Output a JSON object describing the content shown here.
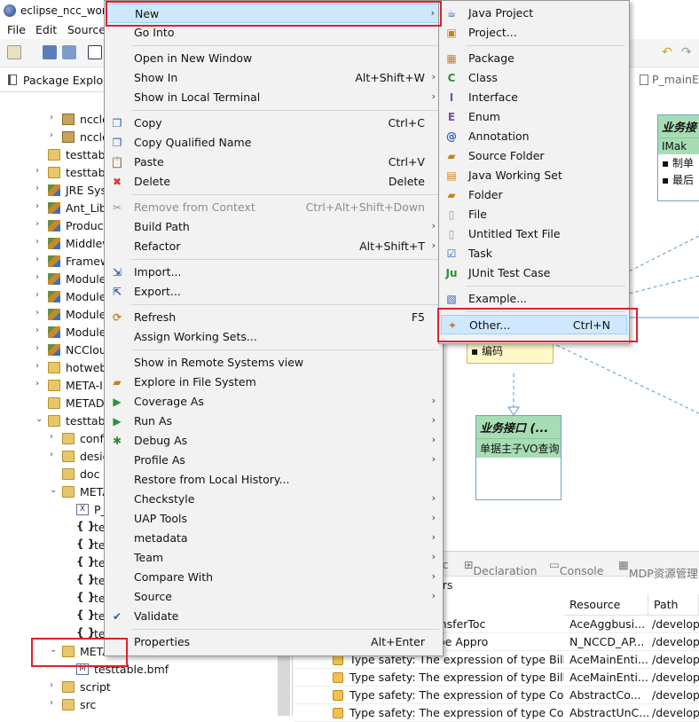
{
  "window": {
    "title": "eclipse_ncc_worl"
  },
  "menubar": {
    "items": [
      "File",
      "Edit",
      "Source"
    ]
  },
  "explorer": {
    "tab_label": "Package Explor",
    "items": [
      {
        "label": "nccloud",
        "indent": 2,
        "arrow": "›",
        "icon": "proj"
      },
      {
        "label": "nccloud",
        "indent": 2,
        "arrow": "›",
        "icon": "proj"
      },
      {
        "label": "testtable/",
        "indent": 1,
        "arrow": "",
        "icon": "folder"
      },
      {
        "label": "testtable/",
        "indent": 1,
        "arrow": "›",
        "icon": "folder"
      },
      {
        "label": "JRE System",
        "indent": 1,
        "arrow": "›",
        "icon": "lib"
      },
      {
        "label": "Ant_Librar",
        "indent": 1,
        "arrow": "›",
        "icon": "lib"
      },
      {
        "label": "Product_C",
        "indent": 1,
        "arrow": "›",
        "icon": "lib"
      },
      {
        "label": "Middlewa",
        "indent": 1,
        "arrow": "›",
        "icon": "lib"
      },
      {
        "label": "Framewor",
        "indent": 1,
        "arrow": "›",
        "icon": "lib"
      },
      {
        "label": "Module_P",
        "indent": 1,
        "arrow": "›",
        "icon": "lib"
      },
      {
        "label": "Module_C",
        "indent": 1,
        "arrow": "›",
        "icon": "lib"
      },
      {
        "label": "Module_P",
        "indent": 1,
        "arrow": "›",
        "icon": "lib"
      },
      {
        "label": "Module_L",
        "indent": 1,
        "arrow": "›",
        "icon": "lib"
      },
      {
        "label": "NCCloud_",
        "indent": 1,
        "arrow": "›",
        "icon": "lib"
      },
      {
        "label": "hotwebs",
        "indent": 1,
        "arrow": "›",
        "icon": "folder"
      },
      {
        "label": "META-INF",
        "indent": 1,
        "arrow": "›",
        "icon": "folder"
      },
      {
        "label": "METADAT",
        "indent": 1,
        "arrow": "",
        "icon": "folder"
      },
      {
        "label": "testtable",
        "indent": 1,
        "arrow": "⌄",
        "icon": "folder"
      },
      {
        "label": "config",
        "indent": 2,
        "arrow": "›",
        "icon": "folder"
      },
      {
        "label": "design",
        "indent": 2,
        "arrow": "›",
        "icon": "folder"
      },
      {
        "label": "doc",
        "indent": 2,
        "arrow": "",
        "icon": "folder"
      },
      {
        "label": "META-",
        "indent": 2,
        "arrow": "⌄",
        "icon": "folder"
      },
      {
        "label": "P_m",
        "indent": 3,
        "arrow": "",
        "icon": "xml"
      },
      {
        "label": "testt",
        "indent": 3,
        "arrow": "",
        "icon": "json"
      },
      {
        "label": "testt",
        "indent": 3,
        "arrow": "",
        "icon": "json"
      },
      {
        "label": "testt",
        "indent": 3,
        "arrow": "",
        "icon": "json"
      },
      {
        "label": "testt",
        "indent": 3,
        "arrow": "",
        "icon": "json"
      },
      {
        "label": "testt",
        "indent": 3,
        "arrow": "",
        "icon": "json"
      },
      {
        "label": "testt",
        "indent": 3,
        "arrow": "",
        "icon": "json"
      },
      {
        "label": "testt",
        "indent": 3,
        "arrow": "",
        "icon": "json"
      },
      {
        "label": "METADATA",
        "indent": 2,
        "arrow": "⌄",
        "icon": "folder"
      },
      {
        "label": "testtable.bmf",
        "indent": 3,
        "arrow": "",
        "icon": "bmf"
      },
      {
        "label": "script",
        "indent": 2,
        "arrow": "›",
        "icon": "folder"
      },
      {
        "label": "src",
        "indent": 2,
        "arrow": "›",
        "icon": "folder"
      }
    ]
  },
  "editor": {
    "tab_label": "P_mainEn",
    "uml_right": {
      "title": "业务接",
      "subtitle": "IMak",
      "items": [
        "制单",
        "最后"
      ]
    },
    "uml_mid_items": [
      "编码"
    ],
    "uml_bottom": {
      "title": "业务接口 (...",
      "subtitle": "单据主子VO查询"
    }
  },
  "bottom": {
    "tabs": [
      "oc",
      "Declaration",
      "Console",
      "MDP资源管理"
    ],
    "subtitle": "ers",
    "columns": [
      "Resource",
      "Path"
    ],
    "rows": [
      {
        "desc": "ocal variable transferToc",
        "resource": "AceAggbusi...",
        "path": "/develop"
      },
      {
        "desc": "expression of type Appro",
        "resource": "N_NCCD_AP...",
        "path": "/develop"
      },
      {
        "desc": "Type safety: The expression of type BillCo",
        "resource": "AceMainEnti...",
        "path": "/develop"
      },
      {
        "desc": "Type safety: The expression of type BillCo",
        "resource": "AceMainEnti...",
        "path": "/develop"
      },
      {
        "desc": "Type safety: The expression of type Collec",
        "resource": "AbstractCo...",
        "path": "/develop"
      },
      {
        "desc": "Type safety: The expression of type Collec",
        "resource": "AbstractUnC...",
        "path": "/develop"
      }
    ]
  },
  "context_menu": {
    "items": [
      {
        "label": "New",
        "shortcut": "",
        "submenu": true,
        "icon": "",
        "disabled": false,
        "highlighted": true
      },
      {
        "label": "Go Into",
        "shortcut": "",
        "submenu": false,
        "icon": "",
        "disabled": false
      },
      {
        "sep": true
      },
      {
        "label": "Open in New Window",
        "shortcut": "",
        "submenu": false,
        "icon": "",
        "disabled": false
      },
      {
        "label": "Show In",
        "shortcut": "Alt+Shift+W",
        "submenu": true,
        "icon": "",
        "disabled": false
      },
      {
        "label": "Show in Local Terminal",
        "shortcut": "",
        "submenu": true,
        "icon": "",
        "disabled": false
      },
      {
        "sep": true
      },
      {
        "label": "Copy",
        "shortcut": "Ctrl+C",
        "submenu": false,
        "icon": "copy",
        "disabled": false
      },
      {
        "label": "Copy Qualified Name",
        "shortcut": "",
        "submenu": false,
        "icon": "copy",
        "disabled": false
      },
      {
        "label": "Paste",
        "shortcut": "Ctrl+V",
        "submenu": false,
        "icon": "paste",
        "disabled": false
      },
      {
        "label": "Delete",
        "shortcut": "Delete",
        "submenu": false,
        "icon": "delete",
        "disabled": false
      },
      {
        "sep": true
      },
      {
        "label": "Remove from Context",
        "shortcut": "Ctrl+Alt+Shift+Down",
        "submenu": false,
        "icon": "remove",
        "disabled": true
      },
      {
        "label": "Build Path",
        "shortcut": "",
        "submenu": true,
        "icon": "",
        "disabled": false
      },
      {
        "label": "Refactor",
        "shortcut": "Alt+Shift+T",
        "submenu": true,
        "icon": "",
        "disabled": false
      },
      {
        "sep": true
      },
      {
        "label": "Import...",
        "shortcut": "",
        "submenu": false,
        "icon": "import",
        "disabled": false
      },
      {
        "label": "Export...",
        "shortcut": "",
        "submenu": false,
        "icon": "export",
        "disabled": false
      },
      {
        "sep": true
      },
      {
        "label": "Refresh",
        "shortcut": "F5",
        "submenu": false,
        "icon": "refresh",
        "disabled": false
      },
      {
        "label": "Assign Working Sets...",
        "shortcut": "",
        "submenu": false,
        "icon": "",
        "disabled": false
      },
      {
        "sep": true
      },
      {
        "label": "Show in Remote Systems view",
        "shortcut": "",
        "submenu": false,
        "icon": "",
        "disabled": false
      },
      {
        "label": "Explore in File System",
        "shortcut": "",
        "submenu": false,
        "icon": "folder",
        "disabled": false
      },
      {
        "label": "Coverage As",
        "shortcut": "",
        "submenu": true,
        "icon": "coverage",
        "disabled": false
      },
      {
        "label": "Run As",
        "shortcut": "",
        "submenu": true,
        "icon": "run",
        "disabled": false
      },
      {
        "label": "Debug As",
        "shortcut": "",
        "submenu": true,
        "icon": "debug",
        "disabled": false
      },
      {
        "label": "Profile As",
        "shortcut": "",
        "submenu": true,
        "icon": "",
        "disabled": false
      },
      {
        "label": "Restore from Local History...",
        "shortcut": "",
        "submenu": false,
        "icon": "",
        "disabled": false
      },
      {
        "label": "Checkstyle",
        "shortcut": "",
        "submenu": true,
        "icon": "",
        "disabled": false
      },
      {
        "label": "UAP Tools",
        "shortcut": "",
        "submenu": true,
        "icon": "",
        "disabled": false
      },
      {
        "label": "metadata",
        "shortcut": "",
        "submenu": true,
        "icon": "",
        "disabled": false
      },
      {
        "label": "Team",
        "shortcut": "",
        "submenu": true,
        "icon": "",
        "disabled": false
      },
      {
        "label": "Compare With",
        "shortcut": "",
        "submenu": true,
        "icon": "",
        "disabled": false
      },
      {
        "label": "Source",
        "shortcut": "",
        "submenu": true,
        "icon": "",
        "disabled": false
      },
      {
        "label": "Validate",
        "shortcut": "",
        "submenu": false,
        "icon": "check",
        "disabled": false
      },
      {
        "sep": true
      },
      {
        "label": "Properties",
        "shortcut": "Alt+Enter",
        "submenu": false,
        "icon": "",
        "disabled": false
      }
    ]
  },
  "new_submenu": {
    "items": [
      {
        "label": "Java Project",
        "shortcut": "",
        "icon": "java-project"
      },
      {
        "label": "Project...",
        "shortcut": "",
        "icon": "project"
      },
      {
        "sep": true
      },
      {
        "label": "Package",
        "shortcut": "",
        "icon": "package"
      },
      {
        "label": "Class",
        "shortcut": "",
        "icon": "class"
      },
      {
        "label": "Interface",
        "shortcut": "",
        "icon": "interface"
      },
      {
        "label": "Enum",
        "shortcut": "",
        "icon": "enum"
      },
      {
        "label": "Annotation",
        "shortcut": "",
        "icon": "annotation"
      },
      {
        "label": "Source Folder",
        "shortcut": "",
        "icon": "source-folder"
      },
      {
        "label": "Java Working Set",
        "shortcut": "",
        "icon": "working-set"
      },
      {
        "label": "Folder",
        "shortcut": "",
        "icon": "folder"
      },
      {
        "label": "File",
        "shortcut": "",
        "icon": "file"
      },
      {
        "label": "Untitled Text File",
        "shortcut": "",
        "icon": "text-file"
      },
      {
        "label": "Task",
        "shortcut": "",
        "icon": "task"
      },
      {
        "label": "JUnit Test Case",
        "shortcut": "",
        "icon": "junit"
      },
      {
        "sep": true
      },
      {
        "label": "Example...",
        "shortcut": "",
        "icon": "example"
      },
      {
        "sep": true
      },
      {
        "label": "Other...",
        "shortcut": "Ctrl+N",
        "icon": "other",
        "highlighted": true
      }
    ]
  },
  "colors": {
    "highlight": "#cde8ff",
    "red_box": "#e0202c",
    "uml_header": "#a7ddb4"
  }
}
